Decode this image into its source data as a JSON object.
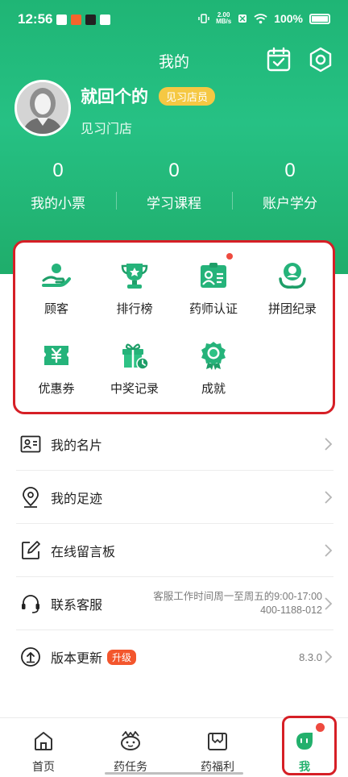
{
  "status_bar": {
    "time": "12:56",
    "net_speed_value": "2.00",
    "net_speed_unit": "MB/s",
    "battery": "100%"
  },
  "header": {
    "title": "我的"
  },
  "profile": {
    "name": "就回个的",
    "role_badge": "见习店员",
    "store": "见习门店"
  },
  "stats": [
    {
      "value": "0",
      "label": "我的小票"
    },
    {
      "value": "0",
      "label": "学习课程"
    },
    {
      "value": "0",
      "label": "账户学分"
    }
  ],
  "features": [
    {
      "label": "顾客",
      "icon": "customer-icon"
    },
    {
      "label": "排行榜",
      "icon": "trophy-icon"
    },
    {
      "label": "药师认证",
      "icon": "certificate-icon"
    },
    {
      "label": "拼团纪录",
      "icon": "group-buy-icon"
    },
    {
      "label": "优惠券",
      "icon": "coupon-icon"
    },
    {
      "label": "中奖记录",
      "icon": "gift-icon"
    },
    {
      "label": "成就",
      "icon": "achievement-icon"
    }
  ],
  "menu": [
    {
      "label": "我的名片",
      "icon": "business-card-icon"
    },
    {
      "label": "我的足迹",
      "icon": "location-pin-icon"
    },
    {
      "label": "在线留言板",
      "icon": "edit-note-icon"
    },
    {
      "label": "联系客服",
      "icon": "headset-icon",
      "hours": "客服工作时间周一至周五的9:00-17:00",
      "phone": "400-1188-012"
    },
    {
      "label": "版本更新",
      "icon": "upload-icon",
      "badge": "升级",
      "version": "8.3.0"
    }
  ],
  "tabs": [
    {
      "label": "首页",
      "icon": "home-icon"
    },
    {
      "label": "药任务",
      "icon": "task-icon"
    },
    {
      "label": "药福利",
      "icon": "welfare-icon"
    },
    {
      "label": "我",
      "icon": "me-icon",
      "active": true
    }
  ],
  "colors": {
    "brand_green": "#22b06c",
    "badge_yellow": "#f5c843",
    "alert_red": "#ee4a3f",
    "upgrade_orange": "#f3562d"
  }
}
